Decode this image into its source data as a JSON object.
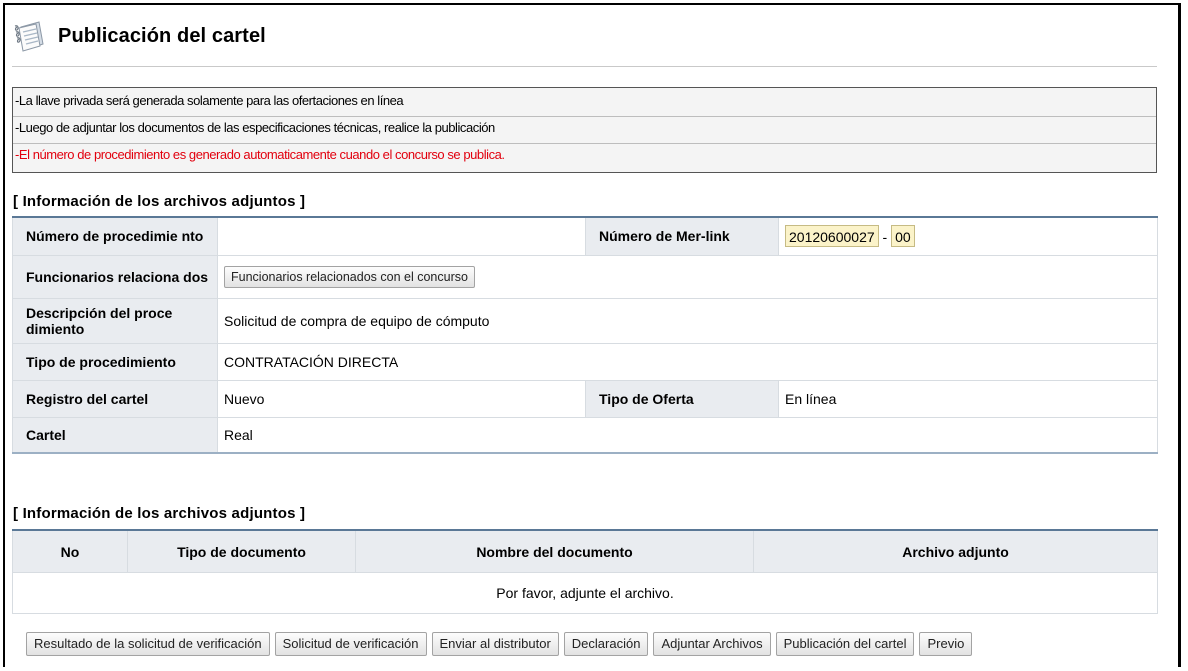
{
  "page": {
    "title": "Publicación del cartel"
  },
  "notice": {
    "lines": [
      "-La llave privada será generada solamente para las ofertaciones en línea",
      "-Luego de adjuntar los documentos de las especificaciones técnicas, realice la publicación",
      "-El número de procedimiento es generado automaticamente cuando el concurso se publica."
    ],
    "highlight_color": "#e2000e"
  },
  "info_section": {
    "title": "[ Información de los archivos adjuntos ]",
    "labels": {
      "numero_procedimiento": "Número de procedimie nto",
      "numero_merlink": "Número de Mer-link",
      "funcionarios": "Funcionarios relaciona dos",
      "descripcion": "Descripción del proce dimiento",
      "tipo_procedimiento": "Tipo de procedimiento",
      "registro": "Registro del cartel",
      "tipo_oferta": "Tipo de Oferta",
      "cartel": "Cartel"
    },
    "values": {
      "numero_procedimiento": "",
      "merlink_number": "20120600027",
      "merlink_separator": "-",
      "merlink_suffix": "00",
      "funcionarios_button": "Funcionarios relacionados con el concurso",
      "descripcion": "Solicitud de compra de equipo de cómputo",
      "tipo_procedimiento": "CONTRATACIÓN DIRECTA",
      "registro": "Nuevo",
      "tipo_oferta": "En línea",
      "cartel": "Real"
    }
  },
  "files_section": {
    "title": "[ Información de los archivos adjuntos ]",
    "columns": [
      "No",
      "Tipo de documento",
      "Nombre del documento",
      "Archivo adjunto"
    ],
    "empty_message": "Por favor, adjunte el archivo."
  },
  "actions": [
    "Resultado de la solicitud de verificación",
    "Solicitud de verificación",
    "Enviar al distributor",
    "Declaración",
    "Adjuntar Archivos",
    "Publicación del cartel",
    "Previo"
  ],
  "icons": {
    "title": "notepad-icon"
  }
}
